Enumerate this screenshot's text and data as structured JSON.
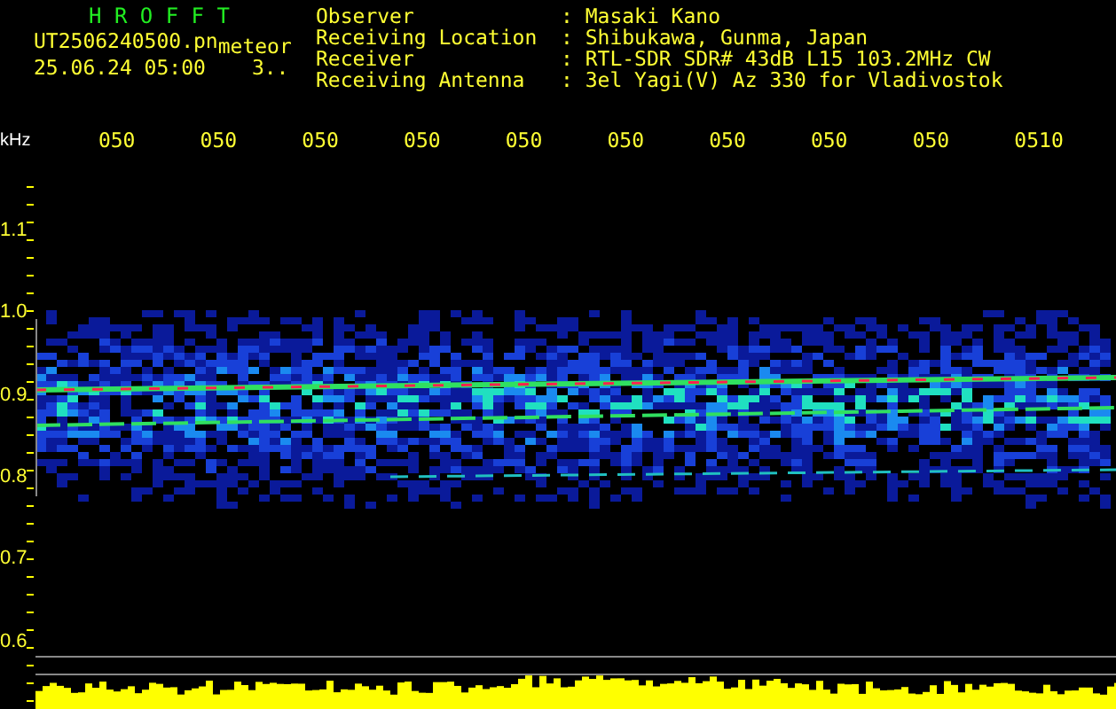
{
  "title": "H R O F F T",
  "file": {
    "name": "UT2506240500.pn",
    "tag": "meteor"
  },
  "timestamp": "25.06.24 05:00",
  "count": "3..",
  "info": [
    {
      "label": "Observer",
      "value": ": Masaki Kano"
    },
    {
      "label": "Receiving Location",
      "value": ": Shibukawa, Gunma, Japan"
    },
    {
      "label": "Receiver",
      "value": ": RTL-SDR SDR# 43dB L15 103.2MHz CW"
    },
    {
      "label": "Receiving Antenna",
      "value": ": 3el Yagi(V) Az 330 for Vladivostok"
    }
  ],
  "unit": "kHz",
  "time_labels": [
    "050",
    "050",
    "050",
    "050",
    "050",
    "050",
    "050",
    "050",
    "050",
    "0510"
  ],
  "freq_labels": [
    "1.1",
    "1.0",
    "0.9",
    "0.8",
    "0.7",
    "0.6"
  ]
}
